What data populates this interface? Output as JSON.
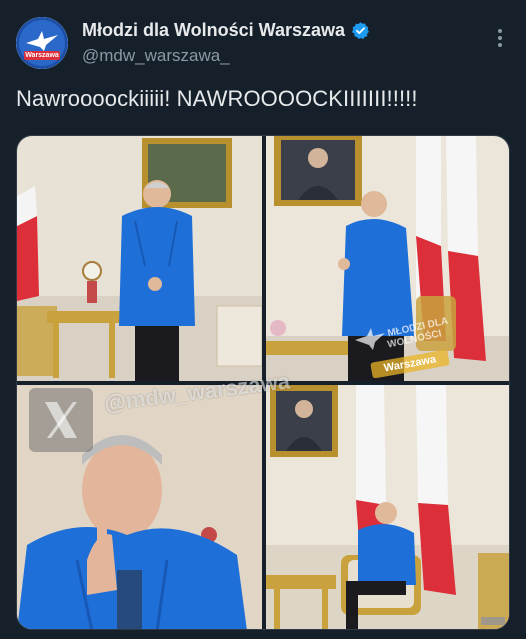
{
  "account": {
    "display_name": "Młodzi dla Wolności Warszawa",
    "handle": "@mdw_warszawa_",
    "avatar_label": "Warszawa",
    "verified": true
  },
  "tweet": {
    "text": "Nawroooockiiiii! NAWROOOOCKIIIIIII!!!!!"
  },
  "media": {
    "watermark_handle": "@mdw_warszawa",
    "watermark_logo_line1": "MŁODZI DLA",
    "watermark_logo_line2": "WOLNOŚCI",
    "watermark_logo_line3": "Warszawa"
  },
  "icons": {
    "more": "more-vertical-icon",
    "verified": "verified-badge-icon",
    "x_logo": "x-logo-icon"
  },
  "colors": {
    "background": "#15202b",
    "text": "#e7e9ea",
    "secondary_text": "#8b98a5",
    "verified_blue": "#1d9bf0",
    "jacket_blue": "#1f6fd8",
    "flag_red": "#dc2f3a"
  }
}
